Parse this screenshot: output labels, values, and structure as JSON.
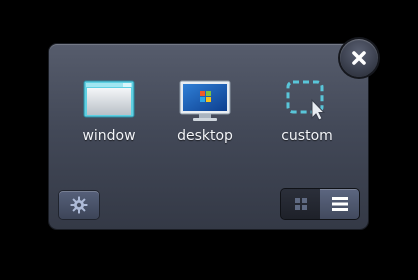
{
  "capture_modes": [
    {
      "id": "window",
      "label": "window",
      "icon": "window-icon"
    },
    {
      "id": "desktop",
      "label": "desktop",
      "icon": "desktop-monitor-icon"
    },
    {
      "id": "custom",
      "label": "custom",
      "icon": "custom-region-cursor-icon"
    }
  ],
  "controls": {
    "close_icon": "close-icon",
    "settings_icon": "gear-icon",
    "view_toggle": {
      "options": [
        "grid-view-icon",
        "list-view-icon"
      ],
      "selected": "list-view-icon"
    }
  },
  "colors": {
    "panel_top": "#565c6c",
    "panel_bottom": "#343946",
    "label_text": "#f2f4f8",
    "accent_cyan": "#59c6d9",
    "background": "#000000"
  }
}
